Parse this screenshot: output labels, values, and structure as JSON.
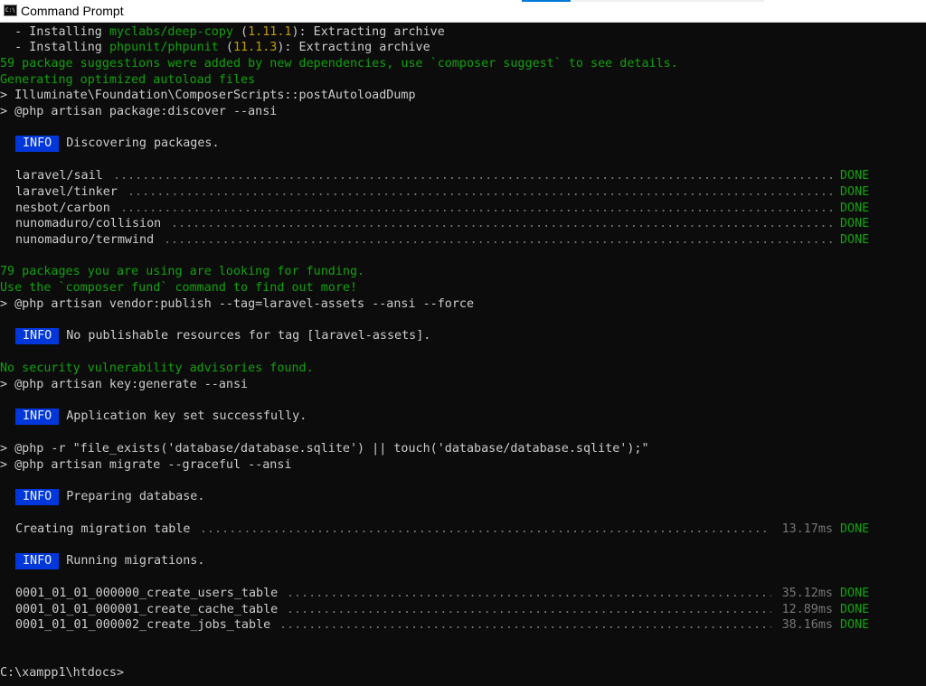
{
  "window": {
    "title": "Command Prompt",
    "icon": "cmd-icon",
    "icon_text": "C:\\"
  },
  "colors": {
    "background": "#0c0c0c",
    "text": "#cccccc",
    "green": "#13a10e",
    "yellow": "#c19c00",
    "info_badge": "#0037da",
    "dots": "#767676"
  },
  "console": {
    "install_lines": [
      {
        "prefix": "  - Installing ",
        "pkg": "myclabs/deep-copy",
        "version": "1.11.1",
        "suffix": "): Extracting archive"
      },
      {
        "prefix": "  - Installing ",
        "pkg": "phpunit/phpunit",
        "version": "11.1.3",
        "suffix": "): Extracting archive"
      }
    ],
    "suggestions": "59 package suggestions were added by new dependencies, use `composer suggest` to see details.",
    "autoload": "Generating optimized autoload files",
    "cmd_post_autoload": "> Illuminate\\Foundation\\ComposerScripts::postAutoloadDump",
    "cmd_package_discover": "> @php artisan package:discover --ansi",
    "info_label": "INFO",
    "info_discovering": "Discovering packages.",
    "packages": [
      {
        "name": "laravel/sail",
        "status": "DONE"
      },
      {
        "name": "laravel/tinker",
        "status": "DONE"
      },
      {
        "name": "nesbot/carbon",
        "status": "DONE"
      },
      {
        "name": "nunomaduro/collision",
        "status": "DONE"
      },
      {
        "name": "nunomaduro/termwind",
        "status": "DONE"
      }
    ],
    "funding_1": "79 packages you are using are looking for funding.",
    "funding_2": "Use the `composer fund` command to find out more!",
    "cmd_vendor_publish": "> @php artisan vendor:publish --tag=laravel-assets --ansi --force",
    "info_no_publishable": "No publishable resources for tag [laravel-assets].",
    "no_security": "No security vulnerability advisories found.",
    "cmd_key_generate": "> @php artisan key:generate --ansi",
    "info_key_set": "Application key set successfully.",
    "cmd_touch_sqlite": "> @php -r \"file_exists('database/database.sqlite') || touch('database/database.sqlite');\"",
    "cmd_migrate": "> @php artisan migrate --graceful --ansi",
    "info_preparing": "Preparing database.",
    "migration_table": {
      "name": "Creating migration table",
      "time": "13.17ms",
      "status": "DONE"
    },
    "info_running": "Running migrations.",
    "migrations": [
      {
        "name": "0001_01_01_000000_create_users_table",
        "time": "35.12ms",
        "status": "DONE"
      },
      {
        "name": "0001_01_01_000001_create_cache_table",
        "time": "12.89ms",
        "status": "DONE"
      },
      {
        "name": "0001_01_01_000002_create_jobs_table",
        "time": "38.16ms",
        "status": "DONE"
      }
    ],
    "prompt": "C:\\xampp1\\htdocs>"
  }
}
